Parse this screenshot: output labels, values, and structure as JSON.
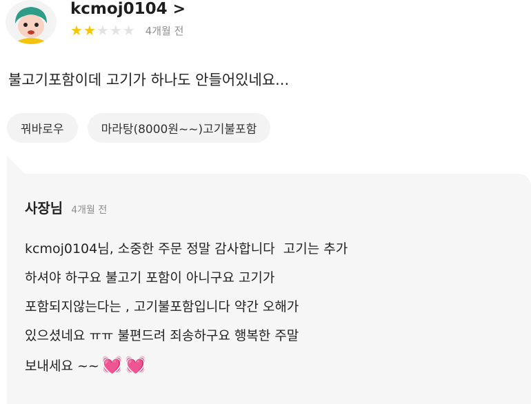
{
  "review": {
    "username": "kcmoj0104",
    "chevron": ">",
    "rating": 2,
    "rating_max": 5,
    "date": "4개월 전",
    "text": "불고기포함이데 고기가 하나도 안들어있네요...",
    "tags": [
      "꿔바로우",
      "마라탕(8000원~~)고기불포함"
    ]
  },
  "reply": {
    "author": "사장님",
    "date": "4개월 전",
    "lines": [
      "kcmoj0104님, 소중한 주문 정말 감사합니다  고기는 추가",
      "하셔야 하구요 불고기 포함이 아니구요 고기가",
      "포함되지않는다는 , 고기불포함입니다 약간 오해가",
      "있으셨네요 ㅠㅠ 불편드려 죄송하구요 행복한 주말",
      "보내세요 ~~"
    ],
    "hearts": [
      "💓",
      "💓"
    ]
  },
  "colors": {
    "star_on": "#f7c600",
    "star_off": "#e3e3e3",
    "reply_bg": "#f6f6f6",
    "tag_bg": "#f3f3f3"
  }
}
